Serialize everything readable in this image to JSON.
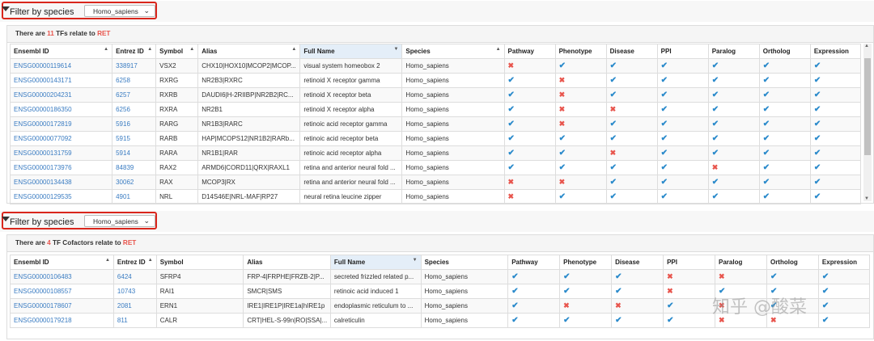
{
  "filter": {
    "label": "Filter by species",
    "value": "Homo_sapiens"
  },
  "columns": [
    "Ensembl ID",
    "Entrez ID",
    "Symbol",
    "Alias",
    "Full Name",
    "Species",
    "Pathway",
    "Phenotype",
    "Disease",
    "PPI",
    "Paralog",
    "Ortholog",
    "Expression"
  ],
  "tfs": {
    "summary": {
      "prefix": "There are",
      "count": "11",
      "middle": "TFs relate to",
      "gene": "RET"
    },
    "rows": [
      {
        "ensembl": "ENSG00000119614",
        "entrez": "338917",
        "symbol": "VSX2",
        "alias": "CHX10|HOX10|MCOP2|MCOP...",
        "full_name": "visual system homeobox 2",
        "species": "Homo_sapiens",
        "flags": [
          0,
          1,
          1,
          1,
          1,
          1,
          1
        ]
      },
      {
        "ensembl": "ENSG00000143171",
        "entrez": "6258",
        "symbol": "RXRG",
        "alias": "NR2B3|RXRC",
        "full_name": "retinoid X receptor gamma",
        "species": "Homo_sapiens",
        "flags": [
          1,
          0,
          1,
          1,
          1,
          1,
          1
        ]
      },
      {
        "ensembl": "ENSG00000204231",
        "entrez": "6257",
        "symbol": "RXRB",
        "alias": "DAUDI6|H-2RIIBP|NR2B2|RC...",
        "full_name": "retinoid X receptor beta",
        "species": "Homo_sapiens",
        "flags": [
          1,
          0,
          1,
          1,
          1,
          1,
          1
        ]
      },
      {
        "ensembl": "ENSG00000186350",
        "entrez": "6256",
        "symbol": "RXRA",
        "alias": "NR2B1",
        "full_name": "retinoid X receptor alpha",
        "species": "Homo_sapiens",
        "flags": [
          1,
          0,
          0,
          1,
          1,
          1,
          1
        ]
      },
      {
        "ensembl": "ENSG00000172819",
        "entrez": "5916",
        "symbol": "RARG",
        "alias": "NR1B3|RARC",
        "full_name": "retinoic acid receptor gamma",
        "species": "Homo_sapiens",
        "flags": [
          1,
          0,
          1,
          1,
          1,
          1,
          1
        ]
      },
      {
        "ensembl": "ENSG00000077092",
        "entrez": "5915",
        "symbol": "RARB",
        "alias": "HAP|MCOPS12|NR1B2|RARb...",
        "full_name": "retinoic acid receptor beta",
        "species": "Homo_sapiens",
        "flags": [
          1,
          1,
          1,
          1,
          1,
          1,
          1
        ]
      },
      {
        "ensembl": "ENSG00000131759",
        "entrez": "5914",
        "symbol": "RARA",
        "alias": "NR1B1|RAR",
        "full_name": "retinoic acid receptor alpha",
        "species": "Homo_sapiens",
        "flags": [
          1,
          1,
          0,
          1,
          1,
          1,
          1
        ]
      },
      {
        "ensembl": "ENSG00000173976",
        "entrez": "84839",
        "symbol": "RAX2",
        "alias": "ARMD6|CORD11|QRX|RAXL1",
        "full_name": "retina and anterior neural fold ...",
        "species": "Homo_sapiens",
        "flags": [
          1,
          1,
          1,
          1,
          0,
          1,
          1
        ]
      },
      {
        "ensembl": "ENSG00000134438",
        "entrez": "30062",
        "symbol": "RAX",
        "alias": "MCOP3|RX",
        "full_name": "retina and anterior neural fold ...",
        "species": "Homo_sapiens",
        "flags": [
          0,
          0,
          1,
          1,
          1,
          1,
          1
        ]
      },
      {
        "ensembl": "ENSG00000129535",
        "entrez": "4901",
        "symbol": "NRL",
        "alias": "D14S46E|NRL-MAF|RP27",
        "full_name": "neural retina leucine zipper",
        "species": "Homo_sapiens",
        "flags": [
          0,
          1,
          1,
          1,
          1,
          1,
          1
        ]
      }
    ]
  },
  "cofactors": {
    "summary": {
      "prefix": "There are",
      "count": "4",
      "middle": "TF Cofactors relate to",
      "gene": "RET"
    },
    "rows": [
      {
        "ensembl": "ENSG00000106483",
        "entrez": "6424",
        "symbol": "SFRP4",
        "alias": "FRP-4|FRPHE|FRZB-2|P...",
        "full_name": "secreted frizzled related p...",
        "species": "Homo_sapiens",
        "flags": [
          1,
          1,
          1,
          0,
          0,
          1,
          1
        ]
      },
      {
        "ensembl": "ENSG00000108557",
        "entrez": "10743",
        "symbol": "RAI1",
        "alias": "SMCR|SMS",
        "full_name": "retinoic acid induced 1",
        "species": "Homo_sapiens",
        "flags": [
          1,
          1,
          1,
          0,
          1,
          1,
          1
        ]
      },
      {
        "ensembl": "ENSG00000178607",
        "entrez": "2081",
        "symbol": "ERN1",
        "alias": "IRE1|IRE1P|IRE1a|hIRE1p",
        "full_name": "endoplasmic reticulum to ...",
        "species": "Homo_sapiens",
        "flags": [
          1,
          0,
          0,
          1,
          0,
          1,
          1
        ]
      },
      {
        "ensembl": "ENSG00000179218",
        "entrez": "811",
        "symbol": "CALR",
        "alias": "CRT|HEL-S-99n|RO|SSA|...",
        "full_name": "calreticulin",
        "species": "Homo_sapiens",
        "flags": [
          1,
          1,
          1,
          1,
          0,
          0,
          1
        ]
      }
    ]
  },
  "watermark": "知乎 @酸菜"
}
